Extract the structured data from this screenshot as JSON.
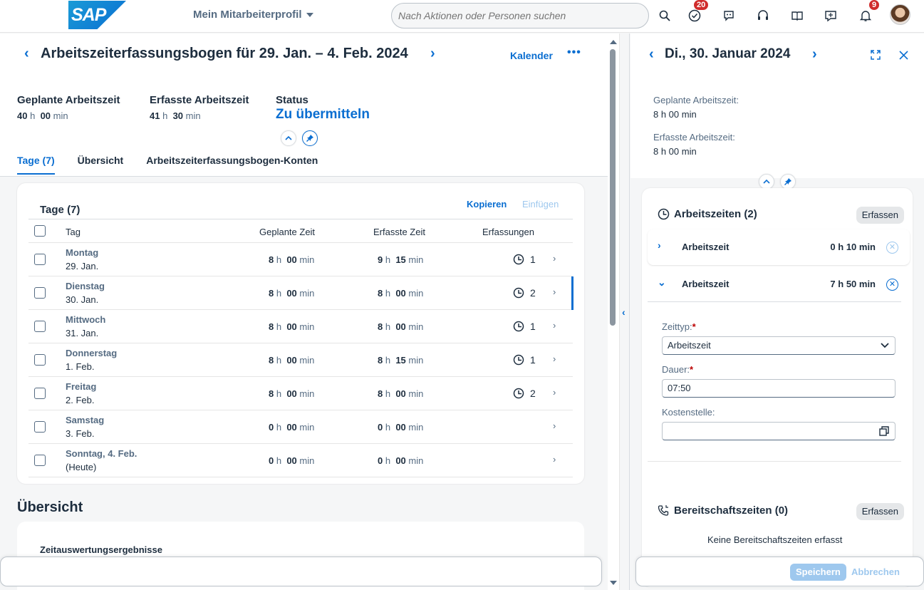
{
  "shell": {
    "logo_text": "SAP",
    "app_title": "Mein Mitarbeiterprofil",
    "search_placeholder": "Nach Aktionen oder Personen suchen",
    "tasks_badge": "20",
    "notifications_badge": "9"
  },
  "page": {
    "title": "Arbeitszeiterfassungsbogen für 29. Jan. – 4. Feb. 2024",
    "calendar_link": "Kalender",
    "more": "•••",
    "kpis": {
      "planned_label": "Geplante Arbeitszeit",
      "planned_h": "40",
      "planned_m": "00",
      "recorded_label": "Erfasste Arbeitszeit",
      "recorded_h": "41",
      "recorded_m": "30",
      "status_label": "Status",
      "status_value": "Zu übermitteln",
      "h_unit": "h",
      "min_unit": "min"
    },
    "tabs": [
      "Tage (7)",
      "Übersicht",
      "Arbeitszeiterfassungsbogen-Konten"
    ]
  },
  "days_table": {
    "title": "Tage (7)",
    "copy": "Kopieren",
    "paste": "Einfügen",
    "headers": {
      "day": "Tag",
      "planned": "Geplante Zeit",
      "recorded": "Erfasste Zeit",
      "entries": "Erfassungen"
    },
    "rows": [
      {
        "day": "Montag",
        "date": "29. Jan.",
        "ph": "8",
        "pm": "00",
        "rh": "9",
        "rm": "15",
        "entries": "1"
      },
      {
        "day": "Dienstag",
        "date": "30. Jan.",
        "ph": "8",
        "pm": "00",
        "rh": "8",
        "rm": "00",
        "entries": "2"
      },
      {
        "day": "Mittwoch",
        "date": "31. Jan.",
        "ph": "8",
        "pm": "00",
        "rh": "8",
        "rm": "00",
        "entries": "1"
      },
      {
        "day": "Donnerstag",
        "date": "1. Feb.",
        "ph": "8",
        "pm": "00",
        "rh": "8",
        "rm": "15",
        "entries": "1"
      },
      {
        "day": "Freitag",
        "date": "2. Feb.",
        "ph": "8",
        "pm": "00",
        "rh": "8",
        "rm": "00",
        "entries": "2"
      },
      {
        "day": "Samstag",
        "date": "3. Feb.",
        "ph": "0",
        "pm": "00",
        "rh": "0",
        "rm": "00",
        "entries": ""
      },
      {
        "day": "Sonntag, 4. Feb.",
        "date": "(Heute)",
        "ph": "0",
        "pm": "00",
        "rh": "0",
        "rm": "00",
        "entries": ""
      }
    ]
  },
  "overview": {
    "title": "Übersicht",
    "subtitle": "Zeitauswertungsergebnisse"
  },
  "detail": {
    "title": "Di., 30. Januar 2024",
    "planned_label": "Geplante Arbeitszeit:",
    "planned_value": "8 h 00 min",
    "recorded_label": "Erfasste Arbeitszeit:",
    "recorded_value": "8 h 00 min",
    "work_section": "Arbeitszeiten (2)",
    "record_btn": "Erfassen",
    "entries": [
      {
        "label": "Arbeitszeit",
        "duration": "0 h 10 min"
      },
      {
        "label": "Arbeitszeit",
        "duration": "7 h 50 min"
      }
    ],
    "form": {
      "type_label": "Zeittyp:",
      "type_value": "Arbeitszeit",
      "duration_label": "Dauer:",
      "duration_value": "07:50",
      "cost_center_label": "Kostenstelle:",
      "required": "*"
    },
    "standby_section": "Bereitschaftszeiten (0)",
    "standby_empty": "Keine Bereitschaftszeiten erfasst",
    "save": "Speichern",
    "cancel": "Abbrechen"
  },
  "colors": {
    "accent": "#0a6ed1",
    "badge": "#d02c2c",
    "required": "#bb0000"
  }
}
